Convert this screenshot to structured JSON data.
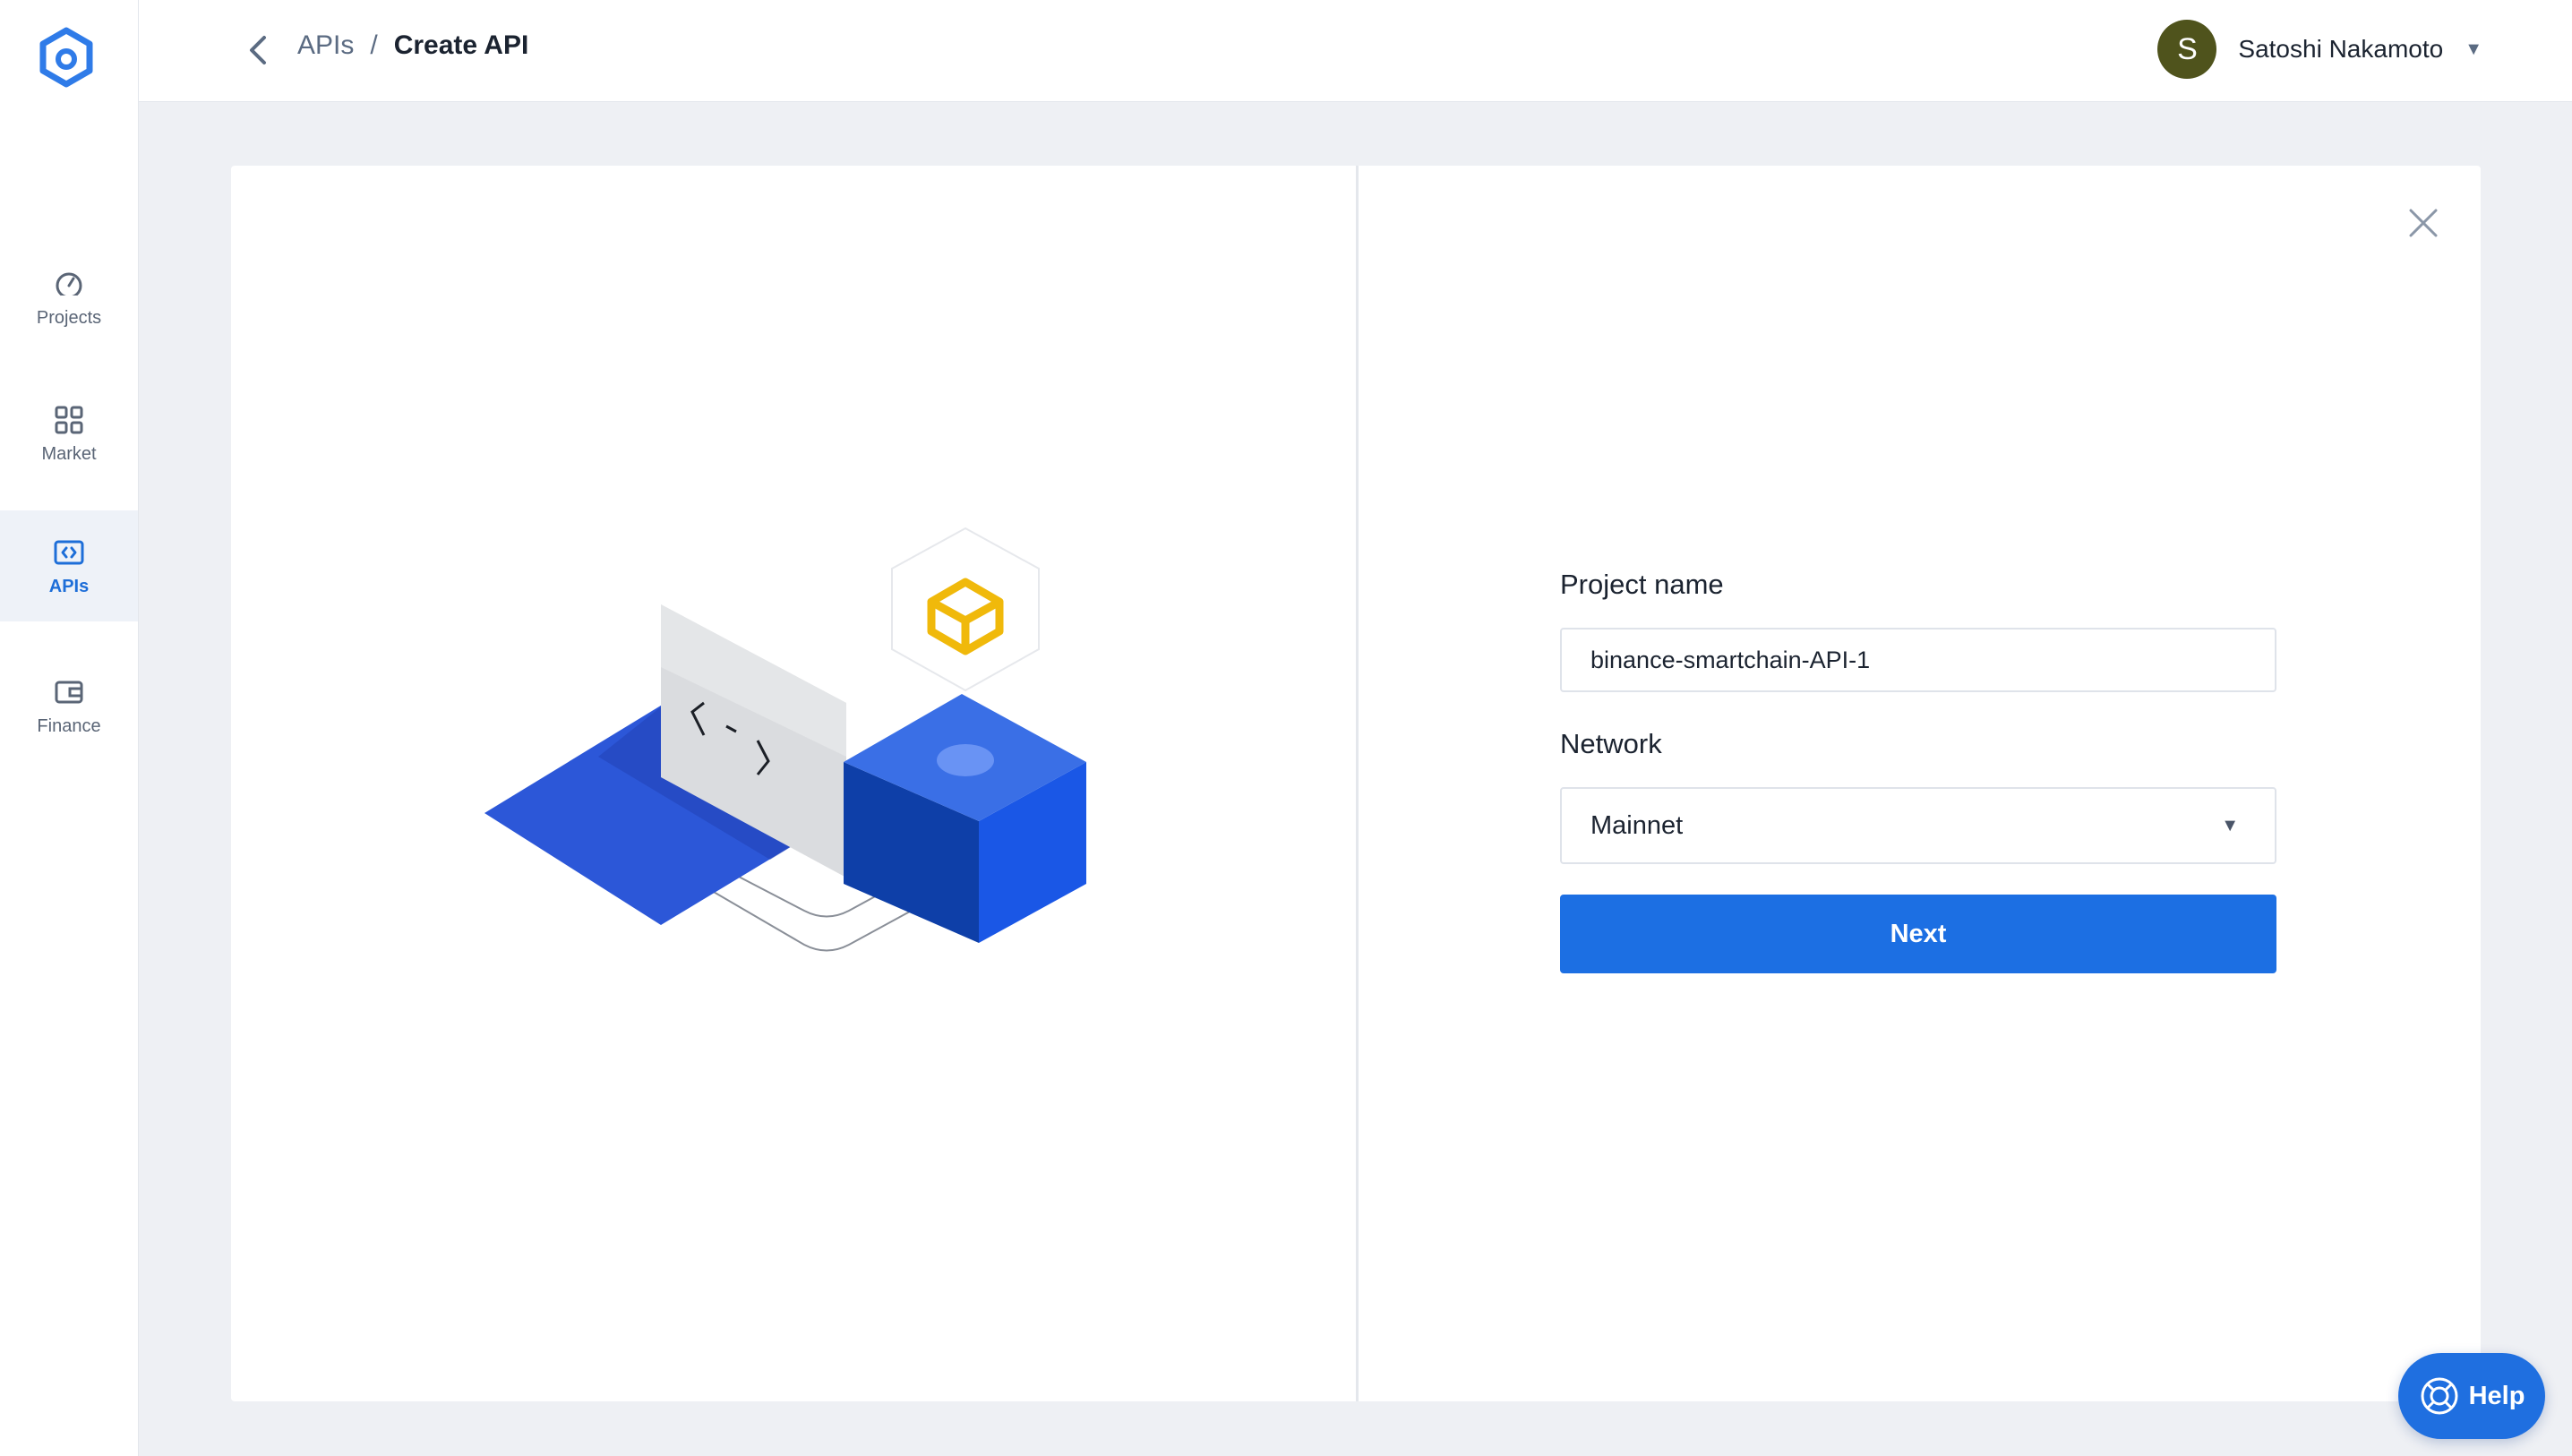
{
  "nav": {
    "items": [
      {
        "label": "Projects",
        "icon": "gauge-icon",
        "active": false
      },
      {
        "label": "Market",
        "icon": "grid-icon",
        "active": false
      },
      {
        "label": "APIs",
        "icon": "code-icon",
        "active": true
      },
      {
        "label": "Finance",
        "icon": "wallet-icon",
        "active": false
      }
    ]
  },
  "header": {
    "breadcrumb_parent": "APIs",
    "breadcrumb_separator": "/",
    "breadcrumb_current": "Create API",
    "user_initial": "S",
    "user_name": "Satoshi Nakamoto"
  },
  "form": {
    "project_name_label": "Project name",
    "project_name_value": "binance-smartchain-API-1",
    "network_label": "Network",
    "network_value": "Mainnet",
    "next_label": "Next"
  },
  "help": {
    "label": "Help"
  },
  "colors": {
    "accent": "#1c6fe3",
    "avatar": "#4f531c",
    "bnb": "#f0b90b",
    "cube_blue": "#1e5be0"
  }
}
